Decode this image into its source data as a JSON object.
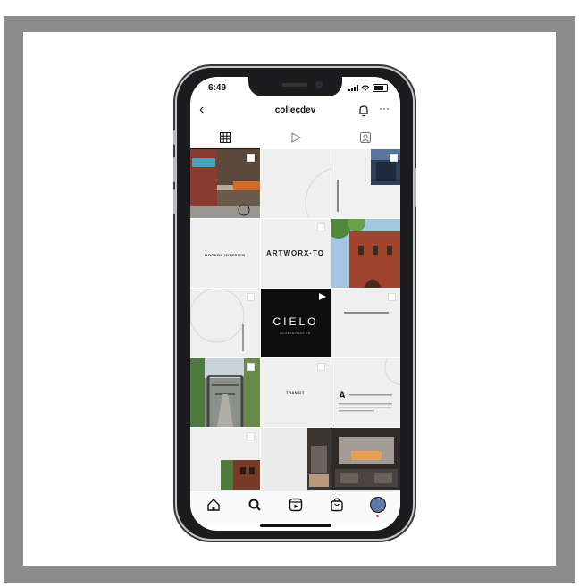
{
  "status_bar": {
    "time": "6:49"
  },
  "header": {
    "back": "‹",
    "username": "collecdev",
    "more": "···"
  },
  "grid_texts": {
    "modern_interior": "MODERN INTERIOR",
    "artworx": "ARTWORX·TO",
    "cielo": "CIELO",
    "cielo_sub": "AN ARCHITECT CO.",
    "transit": "TRANSIT",
    "letter_a": "A"
  },
  "colors": {
    "frame": "#8c8c8c",
    "phone_body": "#1c1c1e",
    "cell_bg": "#efefef"
  }
}
